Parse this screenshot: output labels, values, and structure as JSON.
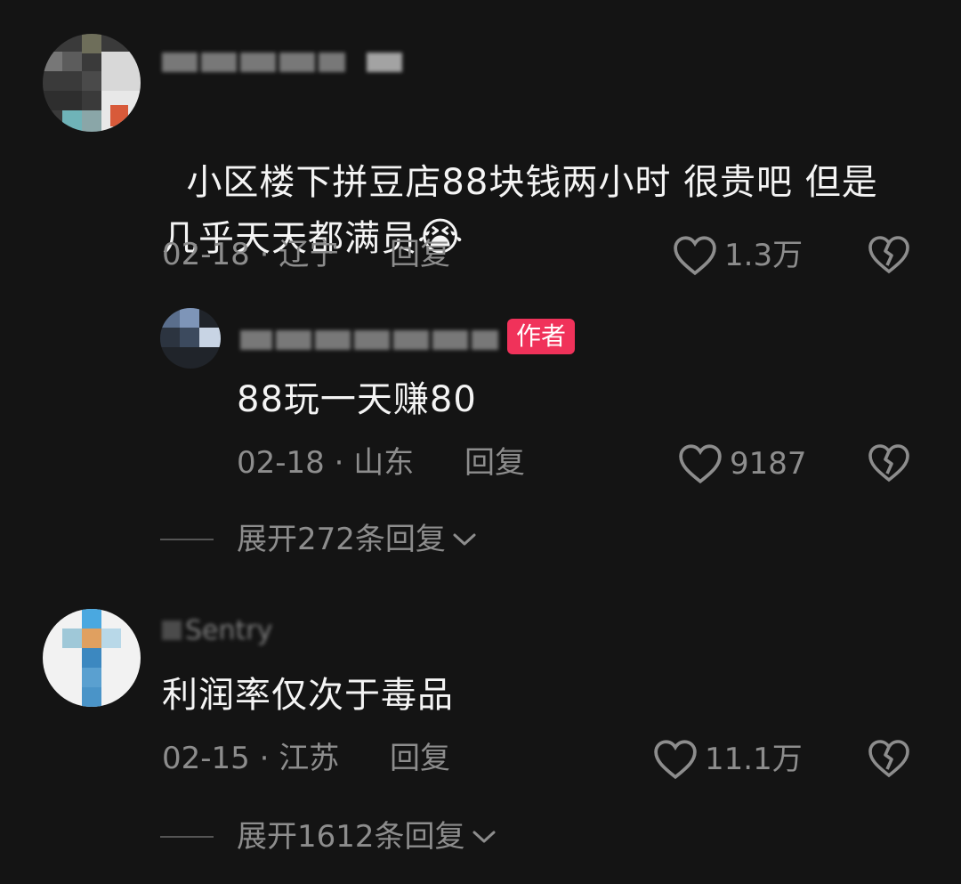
{
  "comments": [
    {
      "text": "小区楼下拼豆店88块钱两小时 很贵吧 但是\n几乎天天都满员",
      "emoji": "😭",
      "date": "02-18",
      "location": "辽宁",
      "reply_label": "回复",
      "likes": "1.3万",
      "reply": {
        "badge": "作者",
        "text": "88玩一天赚80",
        "date": "02-18",
        "location": "山东",
        "reply_label": "回复",
        "likes": "9187"
      },
      "expand_label": "展开272条回复"
    },
    {
      "username_fragment": "Sentry",
      "text": "利润率仅次于毒品",
      "date": "02-15",
      "location": "江苏",
      "reply_label": "回复",
      "likes": "11.1万",
      "expand_label": "展开1612条回复"
    }
  ],
  "colors": {
    "background": "#141414",
    "text": "#f4f4f4",
    "muted": "#8d8d8d",
    "author_badge": "#f0325a"
  },
  "icons": {
    "like": "heart-outline-icon",
    "dislike": "broken-heart-icon",
    "expand": "chevron-down-icon"
  }
}
